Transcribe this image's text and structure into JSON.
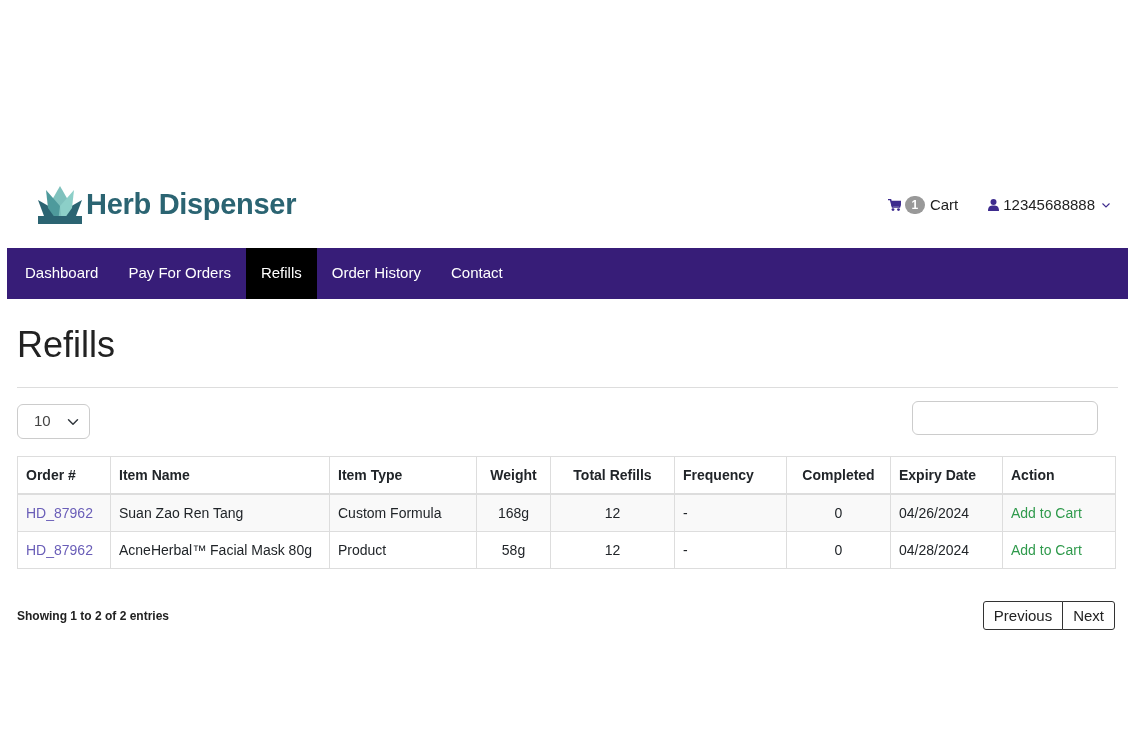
{
  "header": {
    "brand": "Herb Dispenser",
    "cart": {
      "count": "1",
      "label": "Cart"
    },
    "user": {
      "name": "12345688888"
    }
  },
  "nav": [
    {
      "label": "Dashboard",
      "selected": false
    },
    {
      "label": "Pay For Orders",
      "selected": false
    },
    {
      "label": "Refills",
      "selected": true
    },
    {
      "label": "Order History",
      "selected": false
    },
    {
      "label": "Contact",
      "selected": false
    }
  ],
  "page_title": "Refills",
  "page_size": {
    "value": "10"
  },
  "table": {
    "columns": [
      {
        "label": "Order #",
        "kind": "link"
      },
      {
        "label": "Item Name",
        "kind": "text"
      },
      {
        "label": "Item Type",
        "kind": "text"
      },
      {
        "label": "Weight",
        "kind": "number"
      },
      {
        "label": "Total Refills",
        "kind": "number"
      },
      {
        "label": "Frequency",
        "kind": "text"
      },
      {
        "label": "Completed",
        "kind": "number"
      },
      {
        "label": "Expiry Date",
        "kind": "text"
      },
      {
        "label": "Action",
        "kind": "action"
      }
    ],
    "rows": [
      [
        "HD_87962",
        "Suan Zao Ren Tang",
        "Custom Formula",
        "168g",
        "12",
        "-",
        "0",
        "04/26/2024",
        "Add to Cart"
      ],
      [
        "HD_87962",
        "AcneHerbal™ Facial Mask 80g",
        "Product",
        "58g",
        "12",
        "-",
        "0",
        "04/28/2024",
        "Add to Cart"
      ]
    ]
  },
  "footer": {
    "info": "Showing 1 to 2 of 2 entries",
    "pagination": [
      "Previous",
      "Next"
    ]
  }
}
